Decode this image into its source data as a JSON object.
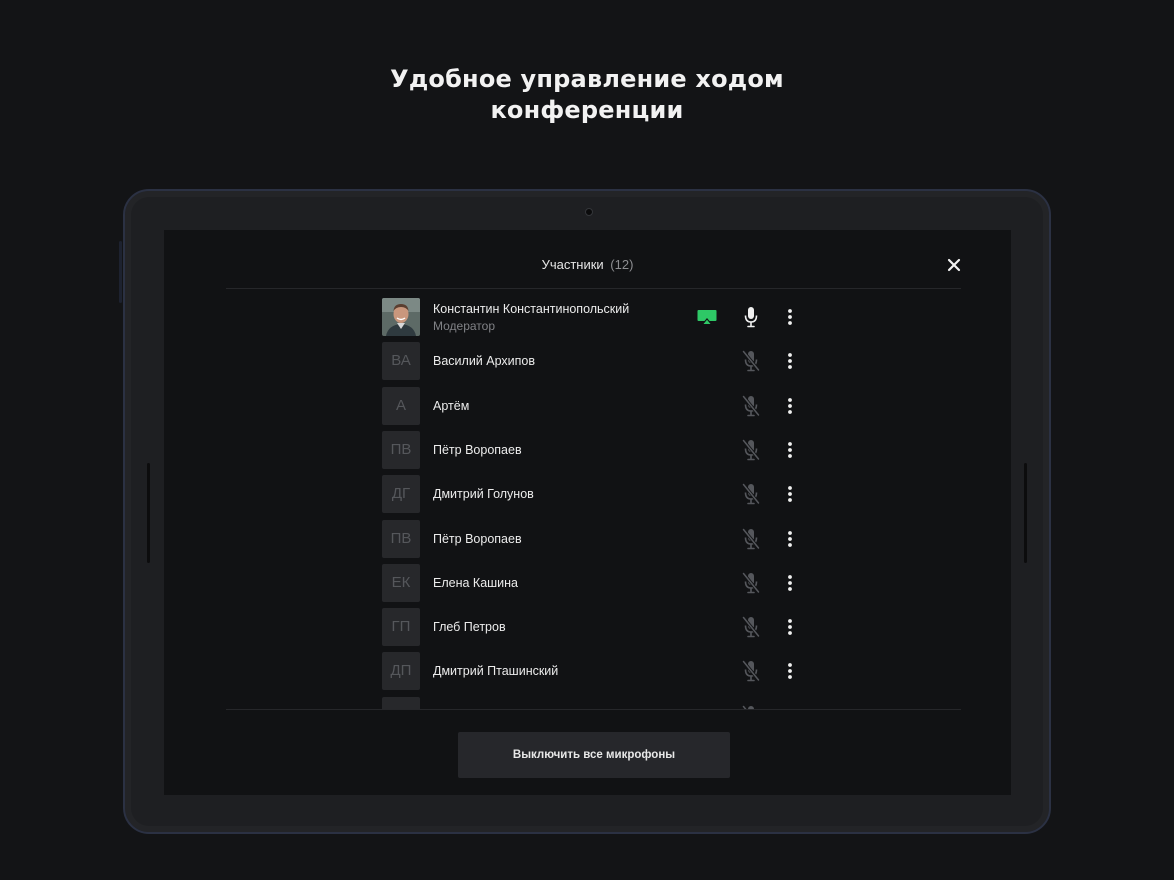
{
  "headline": {
    "line1": "Удобное управление ходом",
    "line2": "конференции"
  },
  "panel": {
    "title": "Участники",
    "count": "(12)",
    "close_icon": "close-icon"
  },
  "participants": [
    {
      "name": "Константин Константинопольский",
      "role": "Модератор",
      "avatar": "photo",
      "initials": "",
      "screen_share": true,
      "mic": "on"
    },
    {
      "name": "Василий Архипов",
      "initials": "ВА",
      "mic": "off"
    },
    {
      "name": "Артём",
      "initials": "А",
      "mic": "off"
    },
    {
      "name": "Пётр Воропаев",
      "initials": "ПВ",
      "mic": "off"
    },
    {
      "name": "Дмитрий Голунов",
      "initials": "ДГ",
      "mic": "off"
    },
    {
      "name": "Пётр Воропаев",
      "initials": "ПВ",
      "mic": "off"
    },
    {
      "name": "Елена Кашина",
      "initials": "ЕК",
      "mic": "off"
    },
    {
      "name": "Глеб Петров",
      "initials": "ГП",
      "mic": "off"
    },
    {
      "name": "Дмитрий Пташинский",
      "initials": "ДП",
      "mic": "off"
    },
    {
      "name": "",
      "initials": "",
      "mic": "off"
    }
  ],
  "footer": {
    "mute_all_label": "Выключить все микрофоны"
  },
  "colors": {
    "background": "#131416",
    "screen": "#111214",
    "accent_green": "#2ec866",
    "avatar_bg": "#27282b",
    "muted_icon": "#5f6166"
  }
}
